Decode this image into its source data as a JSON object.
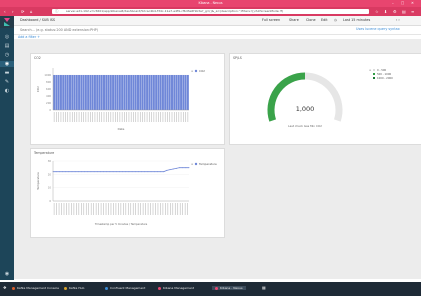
{
  "window": {
    "title": "Kibana - Nexus"
  },
  "browser": {
    "url": "server-ed1-192.vm:5601/app/kibana#/dashboard/52cac4b4-f34c-11e7-a4f9-cf6d3e6f1b3a?_g=()&_a=(description:'',filters:!(),fullScreenMode:!f)"
  },
  "kibana_nav": {
    "breadcrumb": "Dashboard / SUB ISS",
    "actions": [
      "Full screen",
      "Share",
      "Clone",
      "Edit"
    ],
    "time_range": "Last 15 minutes",
    "search_placeholder": "Search... (e.g. status:200 AND extension:PHP)",
    "query_link": "Uses lucene query syntax",
    "add_filter": "Add a filter +"
  },
  "panels": {
    "left_top": {
      "title": "CO2",
      "legend": "CO2",
      "ylabel": "CO2",
      "xlabel": "Date"
    },
    "right_top": {
      "title": "SP/LS",
      "value_label": "1,000",
      "sublabel": "Last check Gas Min CO2",
      "legend": [
        "0 - 500",
        "500 - 1000",
        "1000 - 2000"
      ]
    },
    "left_bottom": {
      "title": "Temperature",
      "legend": "Temperature",
      "ylabel": "Temperature",
      "xlabel": "Timestamp per 5 minutes / Temperature"
    }
  },
  "taskbar": {
    "items": [
      {
        "label": "Kafka Management Console",
        "color": "#d95f2b"
      },
      {
        "label": "Kafka Hub",
        "color": "#d9a32b"
      },
      {
        "label": "Confluent Management",
        "color": "#3a8bd6"
      },
      {
        "label": "Kibana Management",
        "color": "#e8456f"
      },
      {
        "label": "Kibana - Nexus",
        "color": "#e8456f"
      }
    ]
  },
  "chart_data": [
    {
      "type": "bar",
      "title": "CO2",
      "ylabel": "CO2",
      "xlabel": "Date",
      "ylim": [
        0,
        1200
      ],
      "categories_count": 60,
      "values": [
        1000,
        1000,
        1000,
        1000,
        1000,
        1000,
        1000,
        1000,
        1000,
        1000,
        1000,
        1000,
        1000,
        1000,
        1000,
        1000,
        1000,
        1000,
        1000,
        1000,
        1000,
        1000,
        1000,
        1000,
        1000,
        1000,
        1000,
        1000,
        1000,
        1000,
        1000,
        1000,
        1000,
        1000,
        1000,
        1000,
        1000,
        1000,
        1000,
        1000,
        1000,
        1000,
        1000,
        1000,
        1000,
        1000,
        1000,
        1000,
        1000,
        1000,
        1000,
        1000,
        1000,
        1000,
        1000,
        1000,
        1000,
        1000,
        1000,
        1000
      ],
      "series": [
        {
          "name": "CO2"
        }
      ]
    },
    {
      "type": "gauge",
      "value": 1000,
      "ranges": [
        [
          0,
          500
        ],
        [
          500,
          1000
        ],
        [
          1000,
          2000
        ]
      ],
      "colors": [
        "#dddddd",
        "#2f9e44",
        "#1a7a33"
      ]
    },
    {
      "type": "line",
      "title": "Temperature",
      "ylabel": "Temperature",
      "ylim": [
        0,
        30
      ],
      "values": [
        22,
        22,
        22,
        22,
        22,
        22,
        22,
        22,
        22,
        22,
        22,
        22,
        22,
        22,
        22,
        22,
        22,
        22,
        22,
        22,
        22,
        22,
        22,
        22,
        22,
        22,
        22,
        22,
        22,
        22,
        22,
        22,
        22,
        22,
        22,
        22,
        23,
        23.5,
        24,
        24.5,
        25,
        25,
        25,
        25
      ],
      "series": [
        {
          "name": "Temperature"
        }
      ]
    }
  ]
}
